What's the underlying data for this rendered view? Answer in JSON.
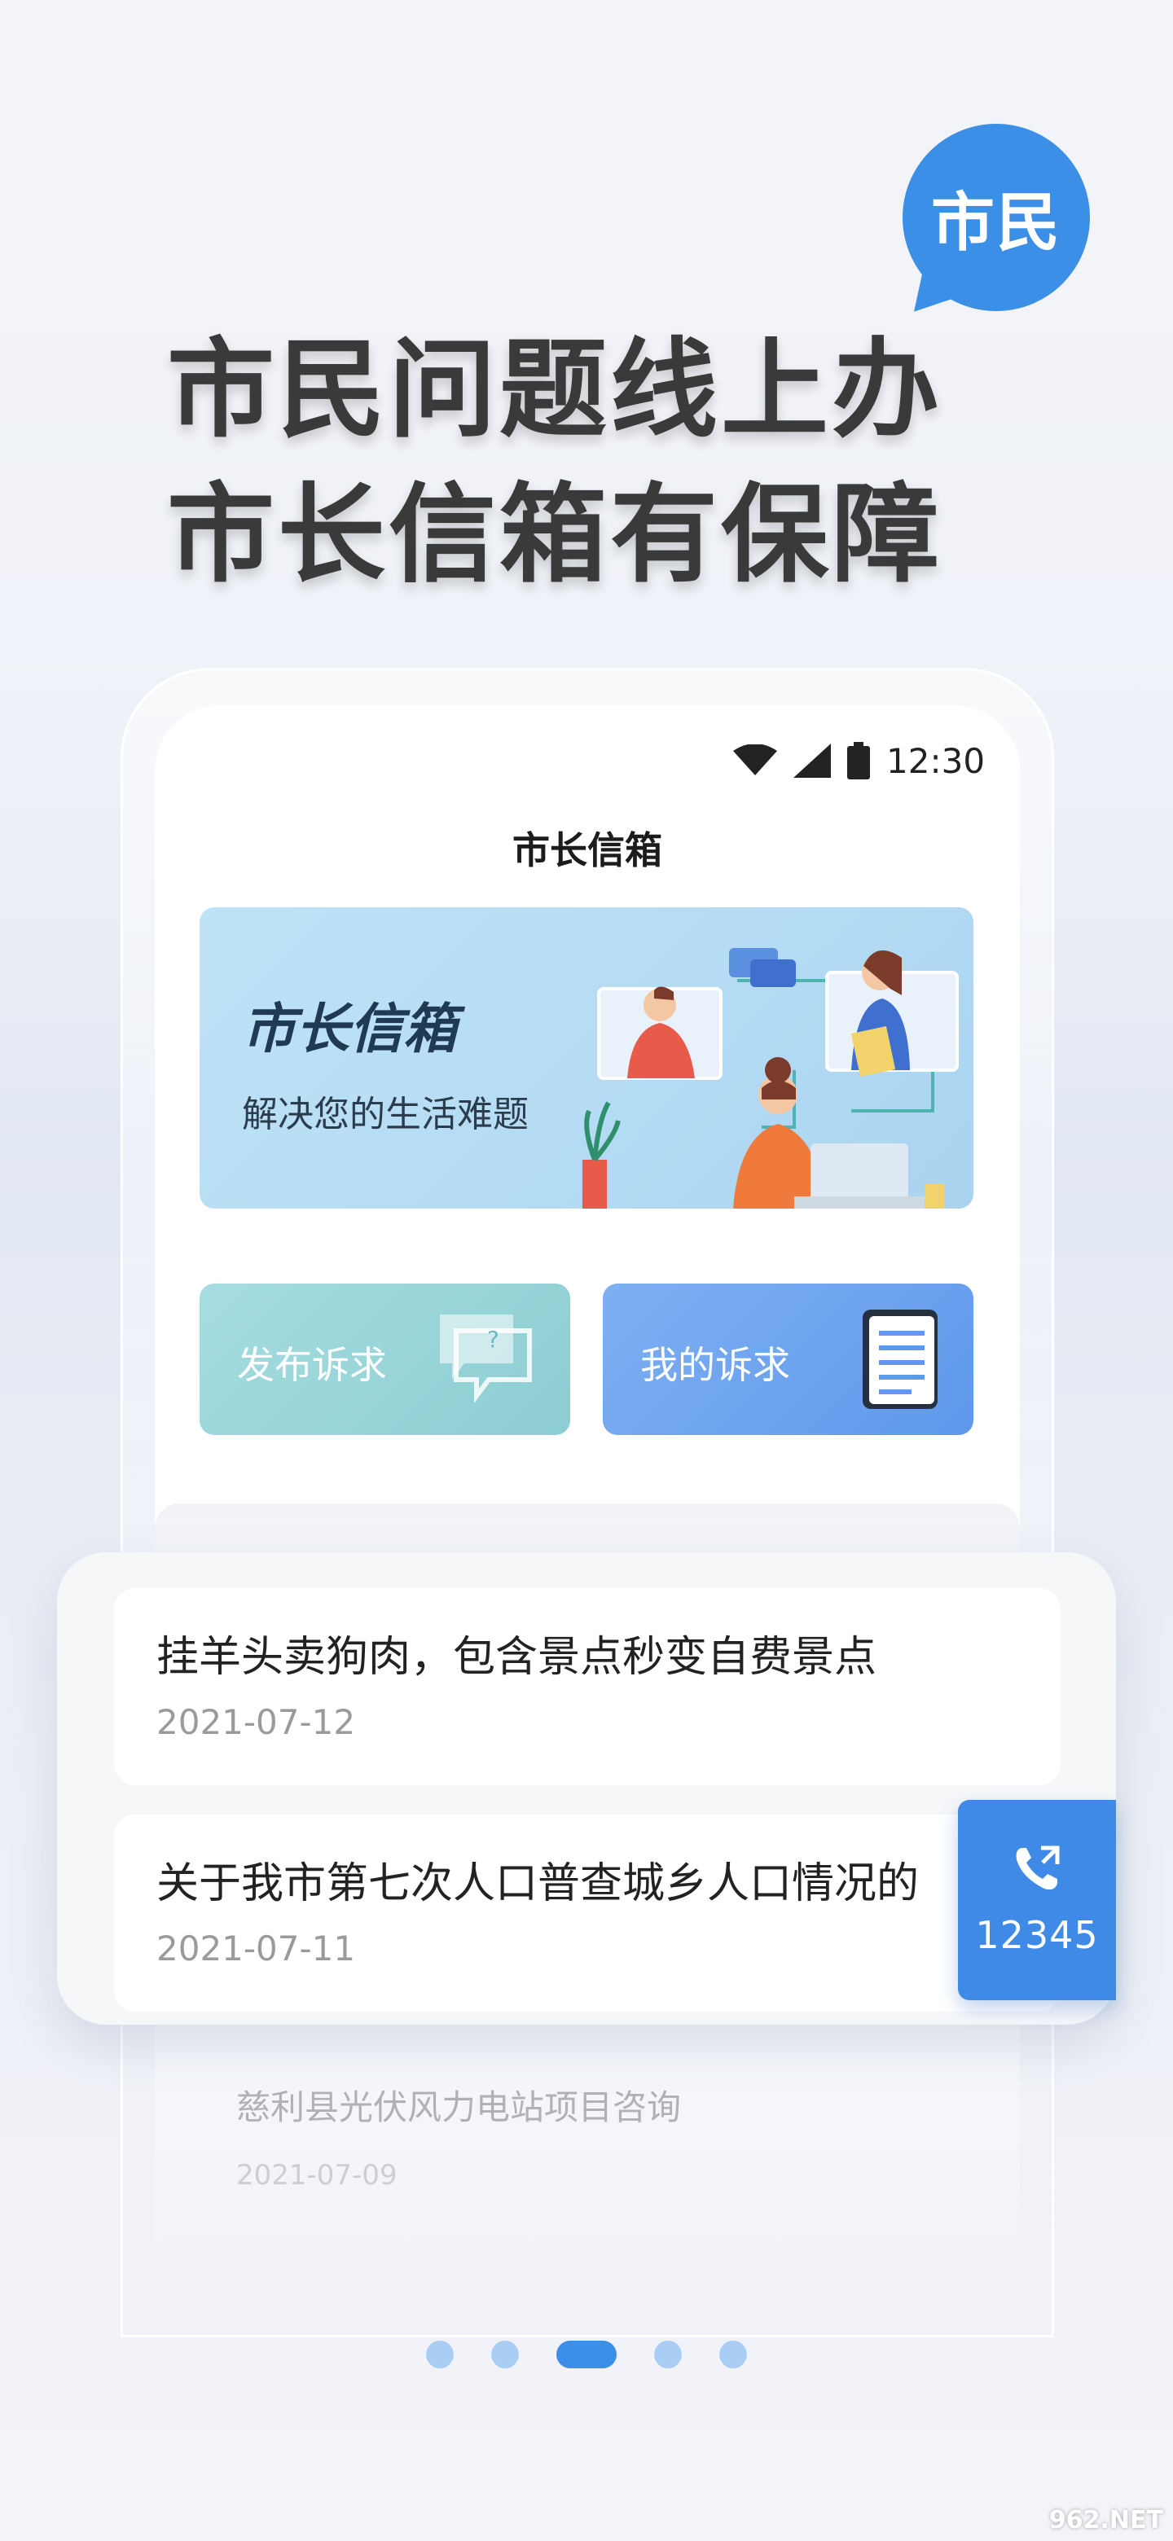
{
  "headline": {
    "bubble_text": "市民",
    "line1": "市民问题线上办",
    "line2": "市长信箱有保障"
  },
  "status_bar": {
    "time": "12:30"
  },
  "app": {
    "title": "市长信箱",
    "banner": {
      "title": "市长信箱",
      "subtitle": "解决您的生活难题"
    },
    "actions": {
      "publish": "发布诉求",
      "mine": "我的诉求"
    }
  },
  "list": {
    "items": [
      {
        "title": "挂羊头卖狗肉，包含景点秒变自费景点",
        "date": "2021-07-12"
      },
      {
        "title": "关于我市第七次人口普查城乡人口情况的",
        "date": "2021-07-11"
      },
      {
        "title": "慈利县光伏风力电站项目咨询",
        "date": "2021-07-09"
      }
    ]
  },
  "hotline": {
    "number": "12345"
  },
  "pager": {
    "total": 5,
    "active_index": 2
  },
  "watermark": "962.NET",
  "colors": {
    "accent": "#3b8fe6",
    "publish_button": "#8ccdd2",
    "mine_button": "#5f98ec"
  }
}
